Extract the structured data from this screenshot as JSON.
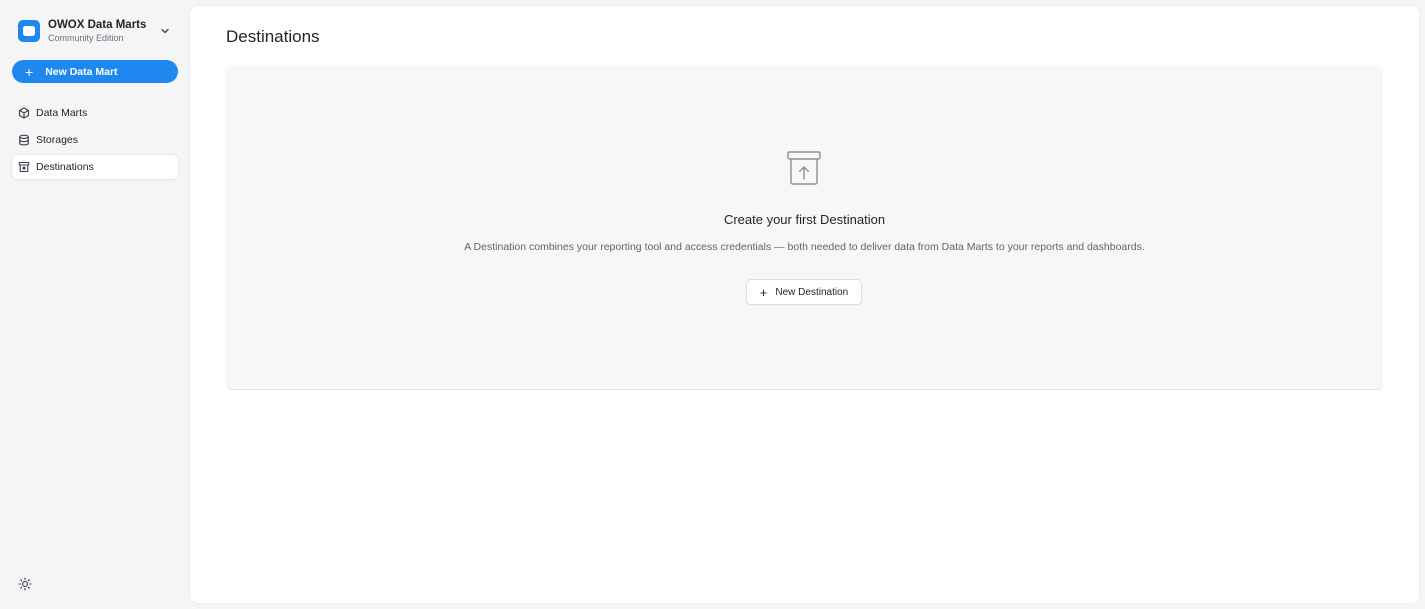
{
  "brand": {
    "title": "OWOX Data Marts",
    "subtitle": "Community Edition",
    "color": "#1e88f0",
    "logo_icon": "owox-logo-icon",
    "chevron_icon": "chevron-down-icon"
  },
  "sidebar": {
    "new_button": {
      "label": "New Data Mart",
      "icon": "plus-icon"
    },
    "items": [
      {
        "label": "Data Marts",
        "icon": "cube-icon",
        "active": false
      },
      {
        "label": "Storages",
        "icon": "database-icon",
        "active": false
      },
      {
        "label": "Destinations",
        "icon": "archive-icon",
        "active": true
      }
    ],
    "theme_toggle_icon": "sun-icon"
  },
  "main": {
    "title": "Destinations",
    "empty_state": {
      "icon": "archive-upload-icon",
      "title": "Create your first Destination",
      "description": "A Destination combines your reporting tool and access credentials — both needed to deliver data from Data Marts to your reports and dashboards.",
      "button_label": "New Destination",
      "button_icon": "plus-icon"
    }
  }
}
